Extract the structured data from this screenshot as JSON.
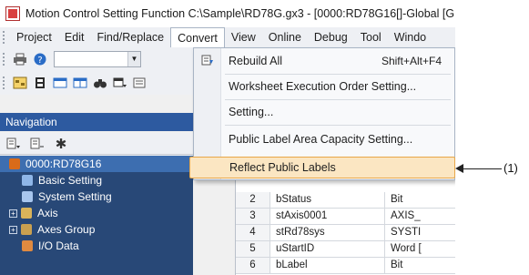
{
  "window": {
    "title": "Motion Control Setting Function C:\\Sample\\RD78G.gx3 - [0000:RD78G16[]-Global [G"
  },
  "menubar": {
    "items": [
      "Project",
      "Edit",
      "Find/Replace",
      "Convert",
      "View",
      "Online",
      "Debug",
      "Tool",
      "Windo"
    ],
    "active": "Convert"
  },
  "convert_menu": {
    "items": [
      {
        "icon": "rebuild-icon",
        "label": "Rebuild All",
        "shortcut": "Shift+Alt+F4"
      },
      {
        "icon": "",
        "label": "Worksheet Execution Order Setting...",
        "shortcut": ""
      },
      {
        "icon": "",
        "label": "Setting...",
        "shortcut": ""
      },
      {
        "icon": "",
        "label": "Public Label Area Capacity Setting...",
        "shortcut": ""
      },
      {
        "icon": "",
        "label": "Reflect Public Labels",
        "shortcut": ""
      }
    ],
    "highlighted": "Reflect Public Labels"
  },
  "navigation": {
    "header": "Navigation",
    "tree": [
      {
        "label": "0000:RD78G16",
        "icon": "module-icon",
        "expander": ""
      },
      {
        "label": "Basic Setting",
        "icon": "basic-setting-icon",
        "expander": ""
      },
      {
        "label": "System Setting",
        "icon": "system-setting-icon",
        "expander": ""
      },
      {
        "label": "Axis",
        "icon": "axis-icon",
        "expander": "+"
      },
      {
        "label": "Axes Group",
        "icon": "axes-group-icon",
        "expander": "+"
      },
      {
        "label": "I/O Data",
        "icon": "io-data-icon",
        "expander": ""
      }
    ]
  },
  "label_grid": {
    "rows": [
      {
        "num": "2",
        "name": "bStatus",
        "type": "Bit"
      },
      {
        "num": "3",
        "name": "stAxis0001",
        "type": "AXIS_"
      },
      {
        "num": "4",
        "name": "stRd78sys",
        "type": "SYSTI"
      },
      {
        "num": "5",
        "name": "uStartID",
        "type": "Word ["
      },
      {
        "num": "6",
        "name": "bLabel",
        "type": "Bit"
      }
    ]
  },
  "callout": {
    "label": "(1)"
  },
  "colors": {
    "nav_header": "#2d5aa0",
    "nav_tree": "#284877",
    "highlight_fill": "#fbe6c2",
    "highlight_border": "#e8a748"
  }
}
